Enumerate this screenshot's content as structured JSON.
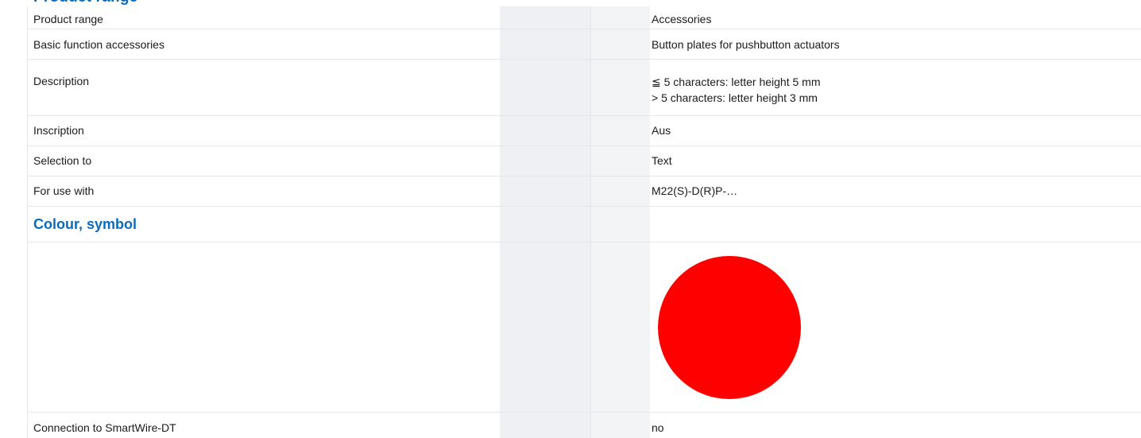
{
  "partial_heading": "Product range",
  "rows": [
    {
      "label": "Product range",
      "value_lines": [
        "Accessories"
      ]
    },
    {
      "label": "Basic function accessories",
      "value_lines": [
        "Button plates for pushbutton actuators"
      ]
    },
    {
      "label": "Description",
      "value_lines": [
        "≦ 5 characters: letter height 5 mm",
        "> 5 characters: letter height 3 mm"
      ]
    },
    {
      "label": "Inscription",
      "value_lines": [
        "Aus"
      ]
    },
    {
      "label": "Selection to",
      "value_lines": [
        "Text"
      ]
    },
    {
      "label": "For use with",
      "value_lines": [
        "M22(S)-D(R)P-…"
      ]
    }
  ],
  "section": {
    "title": "Colour, symbol"
  },
  "colour": {
    "swatch_color": "#ff0000",
    "swatch_icon": "red-circle-symbol"
  },
  "last_row": {
    "label": "Connection to SmartWire-DT",
    "value": "no"
  },
  "colors": {
    "heading_blue": "#0a6bbd",
    "stripe_grey": "#eff0f3",
    "border": "#e4e6ea"
  }
}
